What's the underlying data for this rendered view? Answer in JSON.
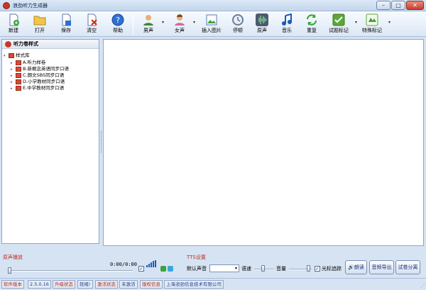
{
  "window": {
    "title": "浪劲听力生成器",
    "min": "–",
    "max": "□",
    "close": "✕"
  },
  "toolbar": {
    "new": "新建",
    "open": "打开",
    "save": "保存",
    "clear": "清空",
    "help": "帮助",
    "male": "男声",
    "female": "女声",
    "insert_image": "插入图片",
    "pause": "停顿",
    "original": "原声",
    "music": "音乐",
    "repeat": "重复",
    "question_mark": "试题标记",
    "special_mark": "特殊标记",
    "dropdown_arrow": "▾"
  },
  "tree": {
    "header": "听力卷样式",
    "root": "样式库",
    "items": [
      {
        "label": "A.听力样卷"
      },
      {
        "label": "B.新概念英语同步口语"
      },
      {
        "label": "C.朗文SBS同步口语"
      },
      {
        "label": "D.小学教材同步口语"
      },
      {
        "label": "E.中学教材同步口语"
      }
    ]
  },
  "playback": {
    "label": "原声播放",
    "time": "0:00/0:00",
    "check": "✓"
  },
  "tts": {
    "label": "TTS设置",
    "voice_label": "默认声音",
    "speed_label": "语速",
    "volume_label": "音量",
    "cursor_track_label": "光标追踪",
    "cursor_track_check": "✓",
    "read_button": "朗读",
    "export_button": "音频导出",
    "split_button": "试卷分离"
  },
  "status": {
    "version_label": "软件版本",
    "version": "2.5.0.16",
    "upgrade_label": "升级状态",
    "upgrade_value": "就绪!",
    "activation_label": "激活状态",
    "activation_value": "未激活",
    "copyright_label": "版权信息",
    "company": "上海浪劲信息技术有限公司"
  },
  "colors": {
    "accent_red": "#c8372b",
    "label_red": "#c03020",
    "link_blue": "#1a3c8a"
  },
  "icons": {
    "new": "new-doc-icon",
    "open": "folder-open-icon",
    "save": "save-doc-icon",
    "clear": "clear-doc-icon",
    "help": "help-icon",
    "male": "male-voice-icon",
    "female": "female-voice-icon",
    "insert_image": "insert-image-icon",
    "pause": "pause-clock-icon",
    "original": "waveform-icon",
    "music": "music-note-icon",
    "repeat": "repeat-arrows-icon",
    "question_mark": "question-mark-icon",
    "special_mark": "special-mark-icon"
  }
}
